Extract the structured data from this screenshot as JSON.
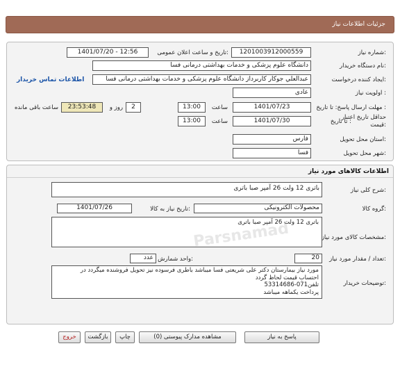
{
  "header": {
    "title": "جزئیات اطلاعات نیاز"
  },
  "details": {
    "need_number_label": "شماره نیاز:",
    "need_number": "1201003912000559",
    "announce_label": "تاریخ و ساعت اعلان عمومی:",
    "announce_value": "1401/07/20 - 12:56",
    "buyer_org_label": "نام دستگاه خریدار:",
    "buyer_org": "دانشگاه علوم پزشکی و خدمات بهداشتی درمانی فسا",
    "requester_label": "ایجاد کننده درخواست:",
    "requester": "عبدالعلي جوكار كاربرداز دانشگاه علوم پزشکی و خدمات بهداشتی درمانی فسا",
    "contact_link": "اطلاعات تماس خریدار",
    "priority_label": "اولویت نیاز :",
    "priority": "عادی",
    "send_deadline_label": "مهلت ارسال پاسخ: تا تاریخ :",
    "send_deadline_date": "1401/07/23",
    "time_label": "ساعت",
    "send_deadline_time": "13:00",
    "days_value": "2",
    "days_label": "روز و",
    "remaining_time": "23:53:48",
    "remaining_label": "ساعت باقی مانده",
    "validity_label_line1": "حداقل تاریخ اعتبار",
    "validity_label_line2": "قیمت:",
    "validity_to_label": "تا تاریخ :",
    "validity_date": "1401/07/30",
    "validity_time": "13:00",
    "province_label": "استان محل تحویل:",
    "province": "فارس",
    "city_label": "شهر محل تحویل:",
    "city": "فسا"
  },
  "goods": {
    "section_title": "اطلاعات کالاهای مورد نیاز",
    "summary_label": "شرح کلی نیاز:",
    "summary": "باتری 12 ولت 26 آمپر صبا باتری",
    "group_label": "گروه کالا:",
    "group": "محصولات الکترونیکی",
    "need_date_label": "تاریخ نیاز به کالا:",
    "need_date": "1401/07/26",
    "spec_label": "مشخصات کالای مورد نیاز:",
    "spec": "باتری 12 ولت 26 آمپر صبا باتری",
    "qty_label": "تعداد / مقدار مورد نیاز:",
    "qty": "20",
    "unit_label": "واحد شمارش:",
    "unit": "عدد",
    "notes_label": "توضیحات خریدار:",
    "notes_lines": [
      "مورد نیاز بیمارستان دکتر علی شریعتی فسا میباشد باطری فرسوده نیز تحویل فروشنده میگردد در",
      "احتساب قیمت لحاظ گردد",
      "تلفن071-53314686",
      "پرداخت یکماهه میباشد"
    ]
  },
  "buttons": {
    "reply": "پاسخ به نیاز",
    "attachments": "مشاهده مدارک پیوستی (0)",
    "print": "چاپ",
    "back": "بازگشت",
    "exit": "خروج"
  }
}
